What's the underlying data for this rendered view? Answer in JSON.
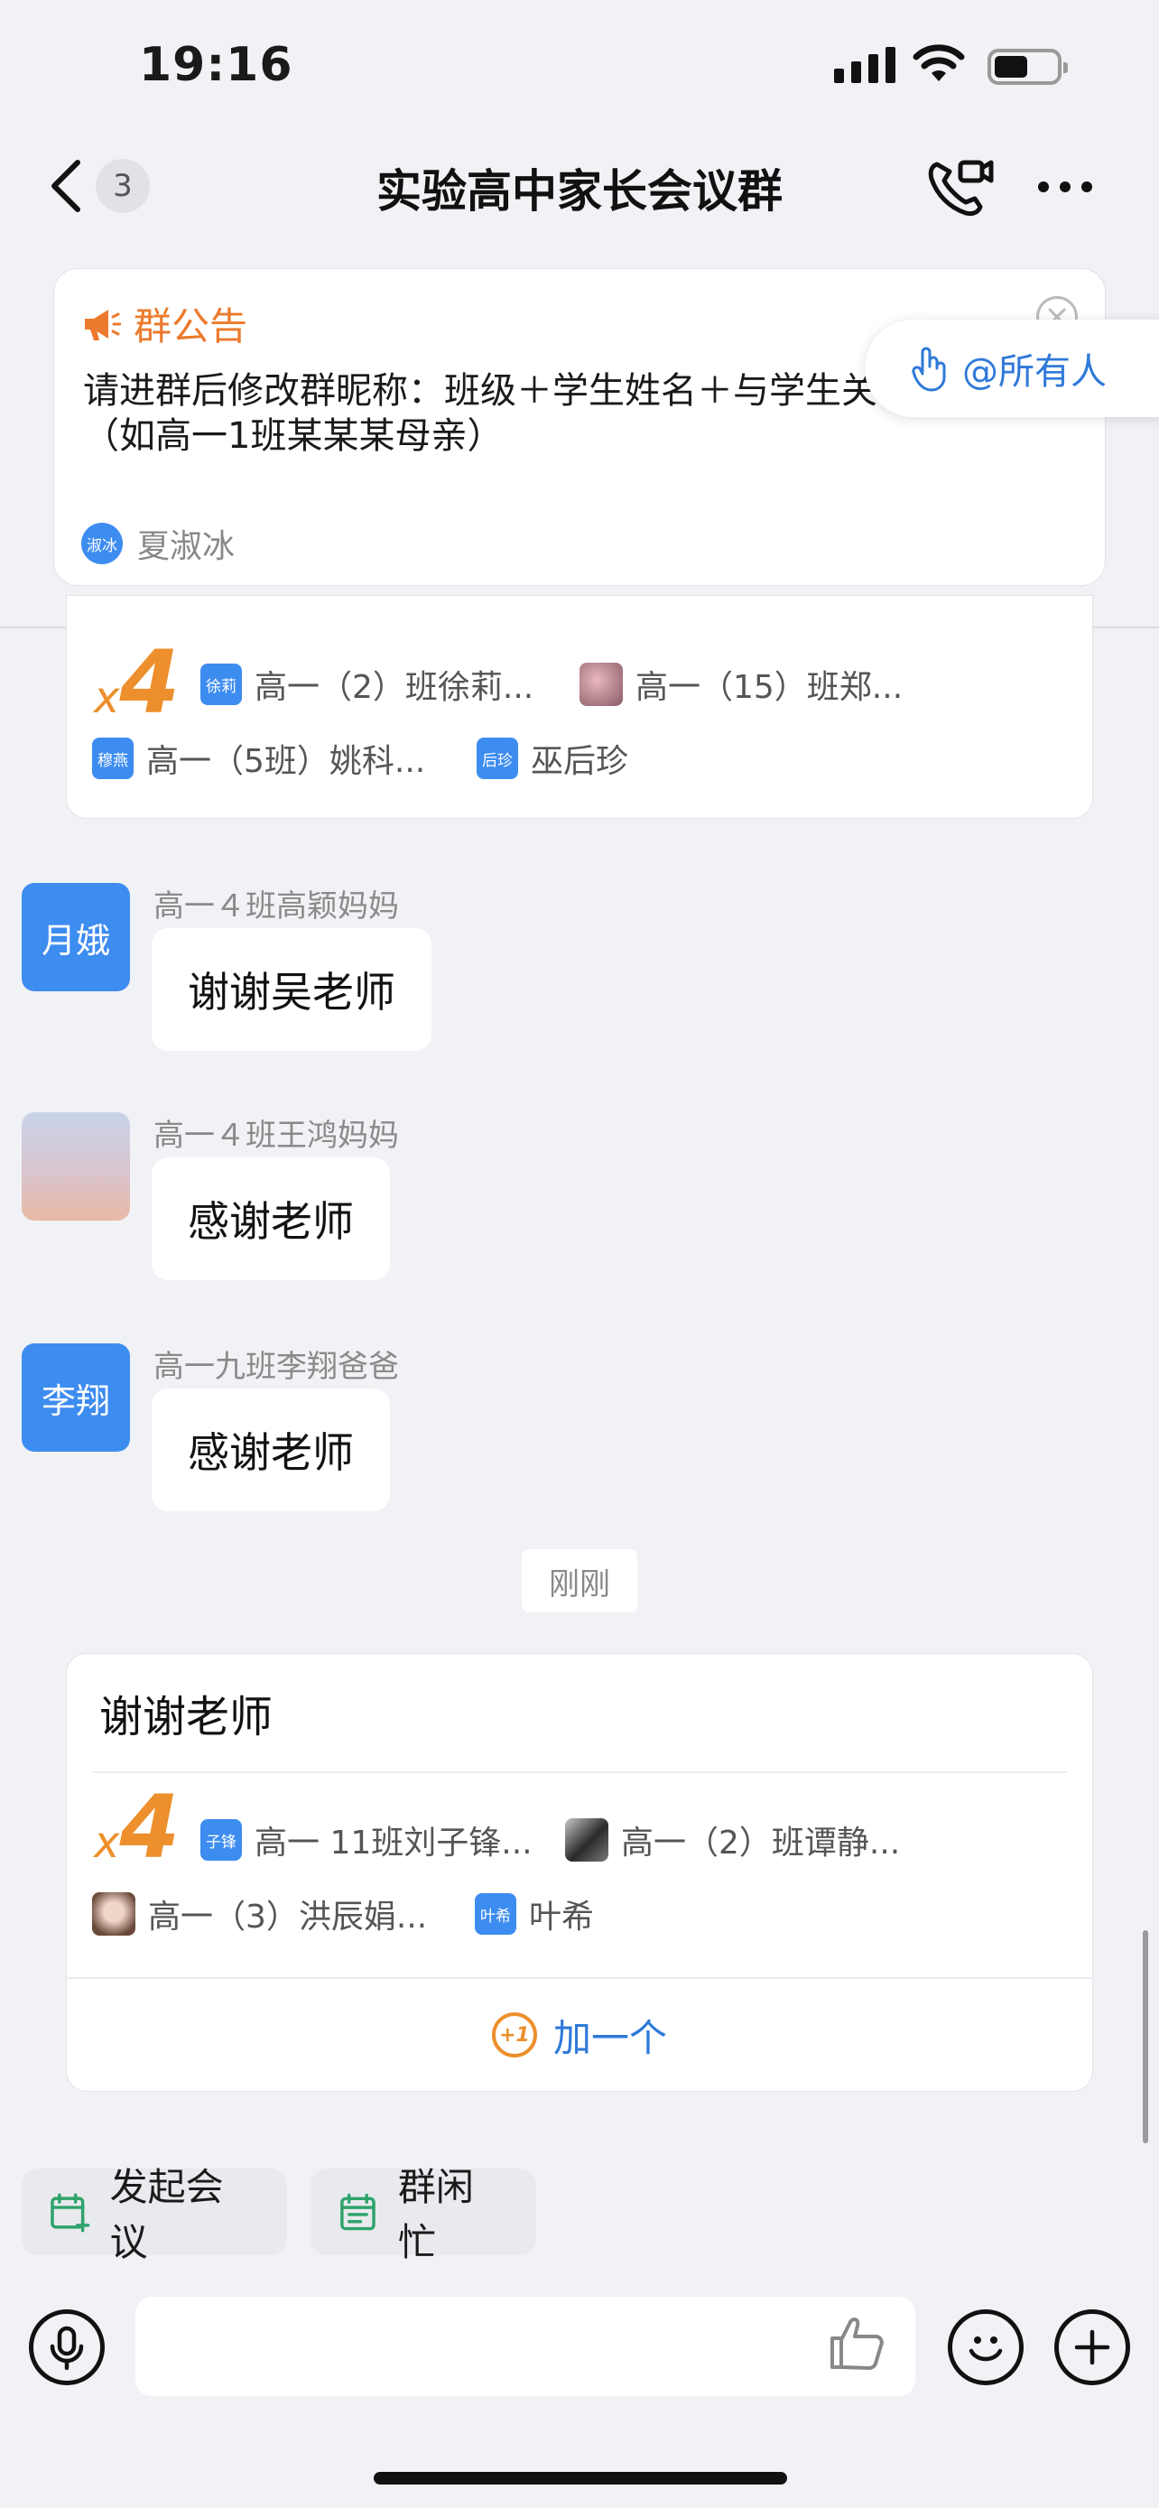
{
  "status_bar": {
    "time": "19:16",
    "battery_level": 0.55
  },
  "nav": {
    "unread_count": "3",
    "title": "实验高中家长会议群"
  },
  "announcement": {
    "label": "群公告",
    "body": "请进群后修改群昵称：班级＋学生姓名＋与学生关系（如高一1班某某某母亲）",
    "author_avatar": "淑冰",
    "author": "夏淑冰"
  },
  "at_all": {
    "label": "@所有人"
  },
  "reaction_card_top": {
    "x": "x",
    "count": "4",
    "users": [
      {
        "avatar_text": "徐莉",
        "name": "高一（2）班徐莉..."
      },
      {
        "avatar_text": "",
        "name": "高一（15）班郑..."
      },
      {
        "avatar_text": "穆燕",
        "name": "高一（5班）姚科..."
      },
      {
        "avatar_text": "后珍",
        "name": "巫后珍"
      }
    ]
  },
  "messages": [
    {
      "avatar_text": "月娥",
      "sender": "高一４班高颖妈妈",
      "text": "谢谢吴老师"
    },
    {
      "avatar_text": "",
      "sender": "高一４班王鸿妈妈",
      "text": "感谢老师"
    },
    {
      "avatar_text": "李翔",
      "sender": "高一九班李翔爸爸",
      "text": "感谢老师"
    }
  ],
  "time_separator": "刚刚",
  "reaction_card_bottom": {
    "message": "谢谢老师",
    "x": "x",
    "count": "4",
    "users": [
      {
        "avatar_text": "子锋",
        "name": "高一 11班刘子锋..."
      },
      {
        "avatar_text": "",
        "name": "高一（2）班谭静..."
      },
      {
        "avatar_text": "",
        "name": "高一（3）洪辰娟..."
      },
      {
        "avatar_text": "叶希",
        "name": "叶希"
      }
    ],
    "plus_icon": "+1",
    "plus_label": "加一个"
  },
  "quick_actions": [
    {
      "label": "发起会议",
      "icon": "calendar-plus-icon"
    },
    {
      "label": "群闲忙",
      "icon": "calendar-icon"
    }
  ],
  "input": {
    "placeholder": ""
  },
  "colors": {
    "accent_blue": "#3d8cf0",
    "link_blue": "#2f79d9",
    "orange": "#ec8f2c",
    "background": "#f1f2f5"
  }
}
